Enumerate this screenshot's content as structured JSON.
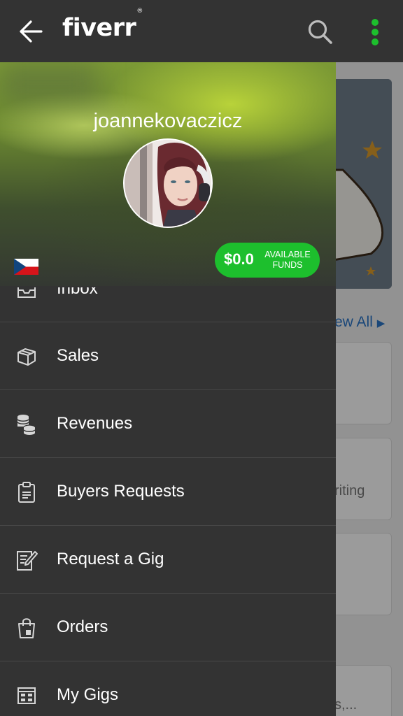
{
  "appbar": {
    "logo": "fiverr",
    "logo_mark": "®",
    "back_icon": "arrow-left-icon",
    "search_icon": "search-icon",
    "more_icon": "more-vertical-icon",
    "accent_color": "#1dbf2d"
  },
  "drawer": {
    "username": "joannekovaczicz",
    "country_flag": "czech-flag-icon",
    "funds": {
      "amount": "$0.0",
      "label": "AVAILABLE FUNDS"
    },
    "menu": [
      {
        "label": "Inbox",
        "icon": "inbox-icon"
      },
      {
        "label": "Sales",
        "icon": "box-icon"
      },
      {
        "label": "Revenues",
        "icon": "coins-icon"
      },
      {
        "label": "Buyers Requests",
        "icon": "clipboard-icon"
      },
      {
        "label": "Request a Gig",
        "icon": "edit-document-icon"
      },
      {
        "label": "Orders",
        "icon": "shopping-bag-icon"
      },
      {
        "label": "My Gigs",
        "icon": "grid-icon"
      }
    ]
  },
  "background": {
    "view_all": "ew All",
    "card_text_1": "riting",
    "card_text_2": "s,..."
  }
}
